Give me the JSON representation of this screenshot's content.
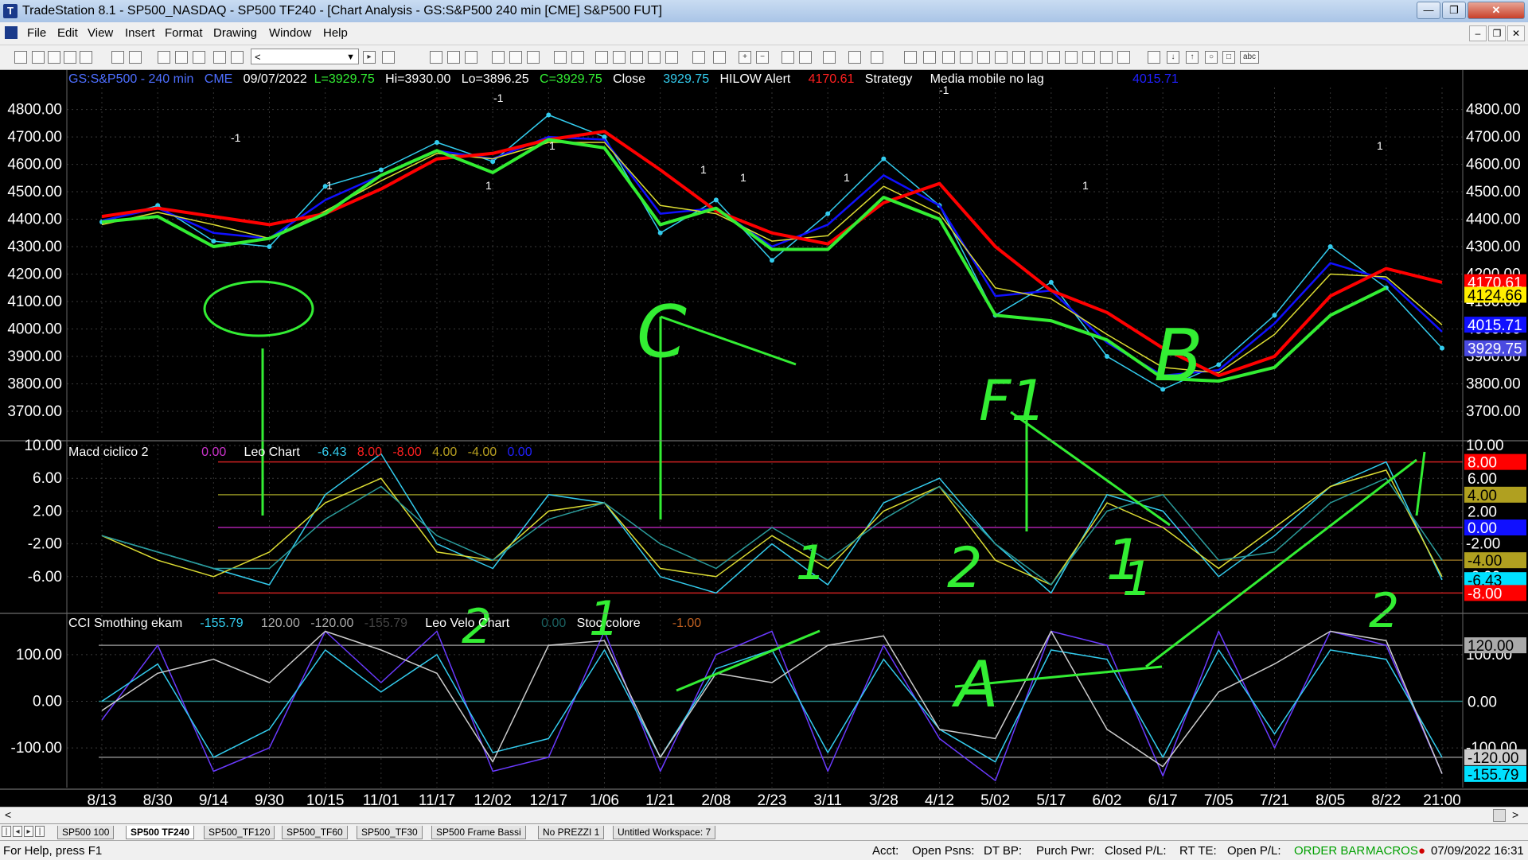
{
  "window": {
    "title": "TradeStation 8.1 - SP500_NASDAQ - SP500 TF240 - [Chart Analysis - GS:S&P500  240 min  [CME] S&P500 FUT]"
  },
  "menu": [
    "File",
    "Edit",
    "View",
    "Insert",
    "Format",
    "Drawing",
    "Window",
    "Help"
  ],
  "toolbar": {
    "symbol_value": "<"
  },
  "price_header": {
    "symbol": "GS:S&P500 - 240 min",
    "exchange": "CME",
    "date": "09/07/2022",
    "last": "L=3929.75",
    "high": "Hi=3930.00",
    "low": "Lo=3896.25",
    "close_val": "C=3929.75",
    "close_label": "Close",
    "close_num": "3929.75",
    "alert": "HILOW Alert",
    "alert_val": "4170.61",
    "strategy": "Strategy",
    "ma_name": "Media mobile no lag",
    "ma_val": "4015.71"
  },
  "macd_header": {
    "name": "Macd ciclico 2",
    "v1": "0.00",
    "name2": "Leo Chart",
    "v2": "-6.43",
    "v3": "8.00",
    "v4": "-8.00",
    "v5": "4.00",
    "v6": "-4.00",
    "v7": "0.00"
  },
  "cci_header": {
    "name": "CCI Smothing ekam",
    "v1": "-155.79",
    "v2": "120.00",
    "v3": "-120.00",
    "v4": "-155.79",
    "name2": "Leo Velo Chart",
    "v5": "0.00",
    "name3": "Stoc colore",
    "v6": "-1.00"
  },
  "colors": {
    "price": "#33ccee",
    "red_ma": "#ff0000",
    "green_ma": "#33ee33",
    "blue_ma": "#1010ff",
    "yellow": "#dddd33",
    "magenta": "#cc33cc",
    "annotation": "#33ee33",
    "axis_bg": "#000000"
  },
  "chart_data": [
    {
      "type": "line",
      "title": "GS:S&P500 - 240 min",
      "x": [
        "8/13",
        "8/30",
        "9/14",
        "9/30",
        "10/15",
        "11/01",
        "11/17",
        "12/02",
        "12/17",
        "1/06",
        "1/21",
        "2/08",
        "2/23",
        "3/11",
        "3/28",
        "4/12",
        "5/02",
        "5/17",
        "6/02",
        "6/17",
        "7/05",
        "7/21",
        "8/05",
        "8/22",
        "21:00"
      ],
      "y_ticks": [
        "4800.00",
        "4700.00",
        "4600.00",
        "4500.00",
        "4400.00",
        "4300.00",
        "4200.00",
        "4100.00",
        "4000.00",
        "3900.00",
        "3800.00",
        "3700.00"
      ],
      "ylim": [
        3610,
        4880
      ],
      "series": [
        {
          "values": [
            4390,
            4450,
            4320,
            4300,
            4520,
            4580,
            4680,
            4610,
            4780,
            4700,
            4350,
            4470,
            4250,
            4420,
            4620,
            4450,
            4050,
            4170,
            3900,
            3780,
            3870,
            4050,
            4300,
            4150,
            3930
          ]
        },
        {
          "values": [
            4395,
            4440,
            4350,
            4330,
            4470,
            4560,
            4650,
            4620,
            4700,
            4690,
            4420,
            4440,
            4300,
            4380,
            4560,
            4450,
            4120,
            4140,
            3950,
            3830,
            3850,
            4020,
            4240,
            4180,
            3990
          ]
        },
        {
          "values": [
            4380,
            4425,
            4380,
            4330,
            4430,
            4540,
            4640,
            4620,
            4680,
            4680,
            4450,
            4420,
            4320,
            4340,
            4520,
            4420,
            4150,
            4110,
            3980,
            3860,
            3840,
            3980,
            4200,
            4190,
            4015
          ]
        },
        {
          "values": [
            4410,
            4440,
            4410,
            4380,
            4420,
            4510,
            4620,
            4640,
            4690,
            4720,
            4580,
            4430,
            4350,
            4310,
            4460,
            4530,
            4300,
            4140,
            4060,
            3930,
            3830,
            3900,
            4120,
            4220,
            4170
          ]
        },
        {
          "values": [
            4390,
            4410,
            4300,
            4330,
            4420,
            4560,
            4650,
            4570,
            4690,
            4660,
            4380,
            4440,
            4290,
            4290,
            4480,
            4400,
            4050,
            4030,
            3960,
            3820,
            3810,
            3860,
            4050,
            4150
          ]
        }
      ],
      "right_labels": [
        "4170.61",
        "4124.66",
        "4015.71",
        "3929.75"
      ]
    },
    {
      "type": "line",
      "title": "Macd ciclico 2",
      "y_ticks": [
        "10.00",
        "6.00",
        "2.00",
        "-2.00",
        "-6.00"
      ],
      "ylim": [
        -10.2,
        10.2
      ],
      "levels": [
        8,
        4,
        0,
        -4,
        -8
      ],
      "series": [
        {
          "values": [
            -1,
            -3,
            -5,
            -7,
            4,
            9,
            -2,
            -5,
            4,
            3,
            -6,
            -8,
            -2,
            -7,
            3,
            6,
            -2,
            -8,
            4,
            2,
            -6,
            -1,
            5,
            8,
            -6.4
          ]
        },
        {
          "values": [
            -1,
            -4,
            -6,
            -3,
            3,
            6,
            -3,
            -4,
            2,
            3,
            -5,
            -6,
            -1,
            -5,
            2,
            5,
            -4,
            -7,
            3,
            0,
            -5,
            0,
            5,
            7,
            -6
          ]
        },
        {
          "values": [
            -1,
            -3,
            -5,
            -5,
            1,
            5,
            -1,
            -4,
            1,
            3,
            -2,
            -5,
            0,
            -4,
            1,
            5,
            -2,
            -7,
            2,
            4,
            -4,
            -3,
            3,
            6,
            -4
          ]
        }
      ],
      "right_labels": [
        "8.00",
        "6.00",
        "4.00",
        "2.00",
        "0.00",
        "-4.00",
        "-6.43",
        "-8.00"
      ]
    },
    {
      "type": "line",
      "title": "CCI Smothing ekam",
      "y_ticks": [
        "100.00",
        "0.00",
        "-100.00"
      ],
      "ylim": [
        -185,
        185
      ],
      "levels": [
        120,
        0,
        -120
      ],
      "series": [
        {
          "values": [
            -40,
            120,
            -150,
            -100,
            150,
            40,
            150,
            -150,
            -120,
            150,
            -150,
            100,
            150,
            -150,
            120,
            -80,
            -170,
            150,
            120,
            -160,
            150,
            -100,
            150,
            120,
            -155
          ]
        },
        {
          "values": [
            0,
            80,
            -120,
            -60,
            110,
            20,
            100,
            -110,
            -80,
            110,
            -120,
            70,
            110,
            -110,
            90,
            -60,
            -130,
            110,
            90,
            -120,
            110,
            -70,
            110,
            90,
            -120
          ]
        },
        {
          "values": [
            -20,
            60,
            90,
            40,
            150,
            110,
            60,
            -130,
            120,
            130,
            -120,
            60,
            40,
            120,
            140,
            -60,
            -80,
            150,
            -60,
            -140,
            20,
            80,
            150,
            130,
            -155
          ]
        }
      ],
      "right_labels": [
        "120.00",
        "0.00",
        "-120.00",
        "-155.79"
      ]
    }
  ],
  "annotations": [
    "-1",
    "1",
    "1",
    "-1",
    "1",
    "1",
    "1",
    "1",
    "-1",
    "1",
    "1",
    "C",
    "F1",
    "B",
    "A",
    "1",
    "2",
    "1",
    "1",
    "2",
    "1",
    "2"
  ],
  "horizontal_scroll": {
    "left": "<",
    "right": ">"
  },
  "workspace_tabs": [
    "SP500 100",
    "SP500 TF240",
    "SP500_TF120",
    "SP500_TF60",
    "SP500_TF30",
    "SP500 Frame Bassi",
    "No PREZZI 1",
    "Untitled Workspace: 7"
  ],
  "status": {
    "help": "For Help, press F1",
    "acct": "Acct:",
    "open_psns": "Open Psns:",
    "dt_bp": "DT BP:",
    "purch_pwr": "Purch Pwr:",
    "closed_pl": "Closed P/L:",
    "rt_te": "RT TE:",
    "open_pl": "Open P/L:",
    "order_bar": "ORDER BAR",
    "macros": "MACROS",
    "datetime": "07/09/2022 16:31"
  }
}
